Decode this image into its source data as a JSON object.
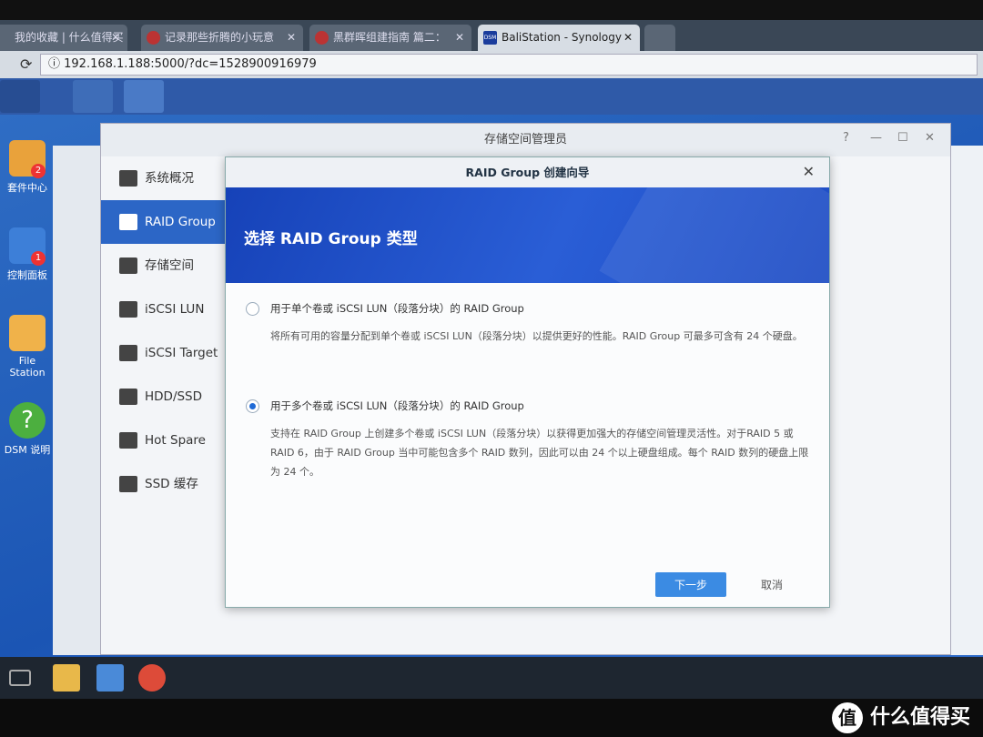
{
  "browser": {
    "tabs": [
      {
        "label": "我的收藏 | 什么值得买",
        "active": false
      },
      {
        "label": "记录那些折腾的小玩意",
        "active": false
      },
      {
        "label": "黑群晖组建指南 篇二：",
        "active": false
      },
      {
        "label": "BaliStation - Synology",
        "active": true,
        "favicon": "DSM"
      }
    ],
    "url": "192.168.1.188:5000/?dc=1528900916979"
  },
  "desktop": {
    "icons": [
      {
        "label": "套件中心",
        "badge": "2"
      },
      {
        "label": "控制面板",
        "badge": "1"
      },
      {
        "label": "File Station"
      },
      {
        "label": "DSM 说明"
      }
    ]
  },
  "window": {
    "title": "存储空间管理员",
    "sidebar": [
      {
        "label": "系统概况",
        "icon": "overview-icon"
      },
      {
        "label": "RAID Group",
        "icon": "raid-icon",
        "active": true
      },
      {
        "label": "存储空间",
        "icon": "volume-icon"
      },
      {
        "label": "iSCSI LUN",
        "icon": "lun-icon"
      },
      {
        "label": "iSCSI Target",
        "icon": "target-icon"
      },
      {
        "label": "HDD/SSD",
        "icon": "disk-icon"
      },
      {
        "label": "Hot Spare",
        "icon": "hot-spare-icon"
      },
      {
        "label": "SSD 缓存",
        "icon": "ssd-cache-icon"
      }
    ]
  },
  "wizard": {
    "title": "RAID Group 创建向导",
    "heading": "选择 RAID Group 类型",
    "options": [
      {
        "title": "用于单个卷或 iSCSI LUN（段落分块）的 RAID Group",
        "desc": "将所有可用的容量分配到单个卷或 iSCSI LUN（段落分块）以提供更好的性能。RAID Group 可最多可含有 24 个硬盘。",
        "selected": false
      },
      {
        "title": "用于多个卷或 iSCSI LUN（段落分块）的 RAID Group",
        "desc": "支持在 RAID Group 上创建多个卷或 iSCSI LUN（段落分块）以获得更加强大的存储空间管理灵活性。对于RAID 5 或 RAID 6，由于 RAID Group 当中可能包含多个 RAID 数列，因此可以由 24 个以上硬盘组成。每个 RAID 数列的硬盘上限为 24 个。",
        "selected": true
      }
    ],
    "next_label": "下一步",
    "cancel_label": "取消"
  },
  "watermark": "什么值得买",
  "colors": {
    "accent": "#2c66c6",
    "banner": "#1d4cc4",
    "desktop": "#1b55b4"
  }
}
